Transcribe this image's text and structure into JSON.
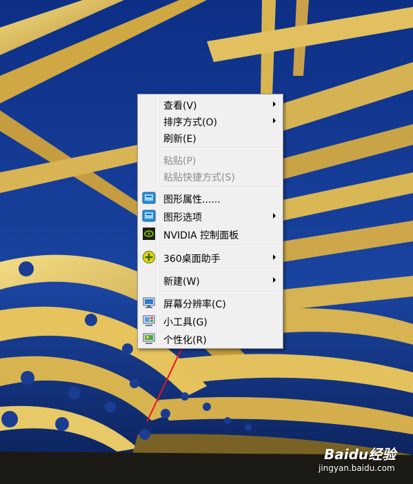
{
  "desktop": {
    "wallpaper": "tunnel-bridge-wallpaper",
    "colors": {
      "sky": "#143a8c",
      "structure": "#e8c45a"
    }
  },
  "context_menu": {
    "items": [
      {
        "label": "查看(V)",
        "submenu": true,
        "disabled": false,
        "icon": ""
      },
      {
        "label": "排序方式(O)",
        "submenu": true,
        "disabled": false,
        "icon": ""
      },
      {
        "label": "刷新(E)",
        "submenu": false,
        "disabled": false,
        "icon": ""
      },
      {
        "label": "粘贴(P)",
        "submenu": false,
        "disabled": true,
        "icon": ""
      },
      {
        "label": "粘贴快捷方式(S)",
        "submenu": false,
        "disabled": true,
        "icon": ""
      },
      {
        "label": "图形属性......",
        "submenu": false,
        "disabled": false,
        "icon": "intel-graphics-icon"
      },
      {
        "label": "图形选项",
        "submenu": true,
        "disabled": false,
        "icon": "intel-graphics-icon"
      },
      {
        "label": "NVIDIA 控制面板",
        "submenu": false,
        "disabled": false,
        "icon": "nvidia-icon"
      },
      {
        "label": "360桌面助手",
        "submenu": true,
        "disabled": false,
        "icon": "360-plus-icon"
      },
      {
        "label": "新建(W)",
        "submenu": true,
        "disabled": false,
        "icon": ""
      },
      {
        "label": "屏幕分辨率(C)",
        "submenu": false,
        "disabled": false,
        "icon": "monitor-icon"
      },
      {
        "label": "小工具(G)",
        "submenu": false,
        "disabled": false,
        "icon": "gadgets-icon"
      },
      {
        "label": "个性化(R)",
        "submenu": false,
        "disabled": false,
        "icon": "personalize-icon"
      }
    ]
  },
  "watermark": {
    "brand": "Baidu经验",
    "url": "jingyan.baidu.com"
  },
  "annotation": {
    "arrow_color": "#e8161b"
  }
}
